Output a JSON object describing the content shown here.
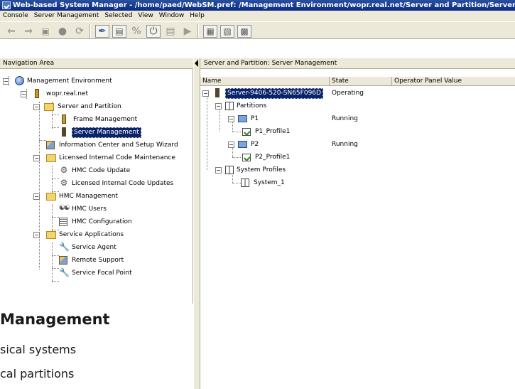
{
  "window": {
    "title": "Web-based System Manager - /home/paed/WebSM.pref: /Management Environment/wopr.real.net/Server and Partition/Server Management"
  },
  "menu": [
    "Console",
    "Server Management",
    "Selected",
    "View",
    "Window",
    "Help"
  ],
  "toolbar": {
    "buttons": [
      "back-icon",
      "forward-icon",
      "up-level-icon",
      "stop-icon",
      "refresh-icon",
      "edit-icon",
      "properties-icon",
      "percent-icon",
      "power-icon",
      "delete-icon",
      "run-icon",
      "large-icons-view-icon",
      "details-view-icon",
      "tree-view-icon"
    ]
  },
  "navigation": {
    "header": "Navigation Area",
    "tree": [
      {
        "label": "Management Environment",
        "icon": "globe-icon"
      },
      {
        "label": "wopr.real.net",
        "icon": "server-tower-icon"
      },
      {
        "label": "Server and Partition",
        "icon": "folder-icon"
      },
      {
        "label": "Frame Management",
        "icon": "frame-icon"
      },
      {
        "label": "Server Management",
        "icon": "server-icon",
        "selected": true
      },
      {
        "label": "Information Center and Setup Wizard",
        "icon": "info-center-icon"
      },
      {
        "label": "Licensed Internal Code Maintenance",
        "icon": "folder-icon"
      },
      {
        "label": "HMC Code Update",
        "icon": "gear-icon"
      },
      {
        "label": "Licensed Internal Code Updates",
        "icon": "gear-icon"
      },
      {
        "label": "HMC Management",
        "icon": "folder-icon"
      },
      {
        "label": "HMC Users",
        "icon": "users-icon"
      },
      {
        "label": "HMC Configuration",
        "icon": "configuration-icon"
      },
      {
        "label": "Service Applications",
        "icon": "folder-icon"
      },
      {
        "label": "Service Agent",
        "icon": "wrench-icon"
      },
      {
        "label": "Remote Support",
        "icon": "remote-support-icon"
      },
      {
        "label": "Service Focal Point",
        "icon": "wrench-icon"
      }
    ]
  },
  "content": {
    "header": "Server and Partition: Server Management",
    "columns": [
      "Name",
      "State",
      "Operator Panel Value"
    ],
    "rows": [
      {
        "name": "Server-9406-520-SN65F096D",
        "state": "Operating",
        "icon": "server-icon",
        "selected": true
      },
      {
        "name": "Partitions",
        "state": "",
        "icon": "partitions-icon"
      },
      {
        "name": "P1",
        "state": "Running",
        "icon": "monitor-icon"
      },
      {
        "name": "P1_Profile1",
        "state": "",
        "icon": "profile-icon"
      },
      {
        "name": "P2",
        "state": "Running",
        "icon": "monitor-icon"
      },
      {
        "name": "P2_Profile1",
        "state": "",
        "icon": "profile-icon"
      },
      {
        "name": "System Profiles",
        "state": "",
        "icon": "system-profiles-icon"
      },
      {
        "name": "System_1",
        "state": "",
        "icon": "system-profiles-icon"
      }
    ]
  },
  "overlay": {
    "title": "Management",
    "lines": [
      "sical systems",
      "cal partitions"
    ]
  },
  "colors": {
    "titlebar": "#0a2a86",
    "selection": "#0a246a",
    "chrome": "#ece9d8"
  }
}
